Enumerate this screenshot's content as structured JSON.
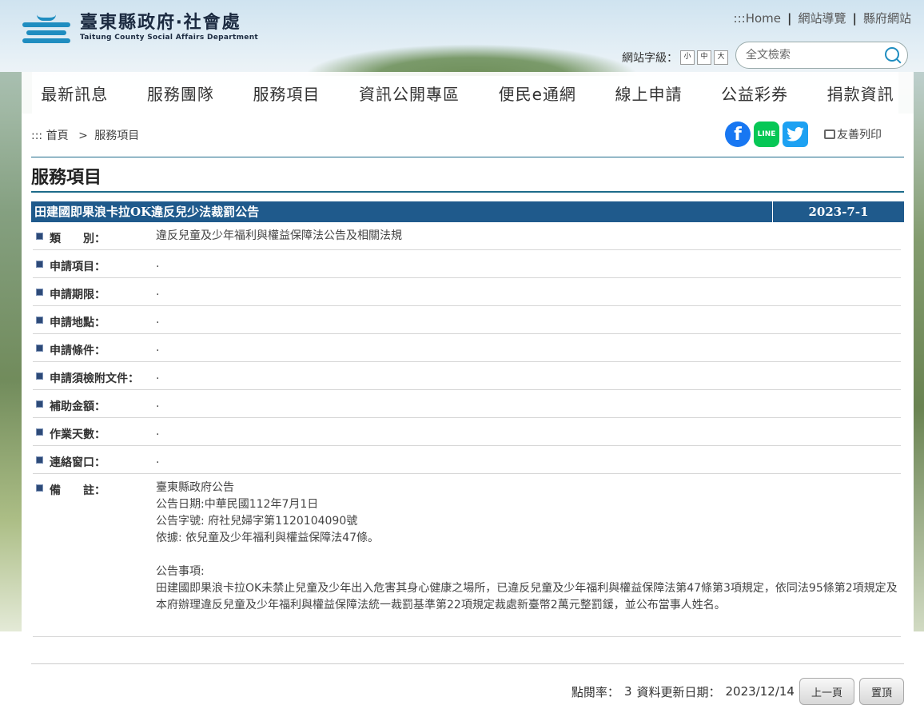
{
  "header": {
    "title": "臺東縣政府‧社會處",
    "subtitle": "Taitung County Social Affairs Department",
    "toplinks": [
      ":::Home",
      "網站導覽",
      "縣府網站"
    ],
    "font_size_label": "網站字級：",
    "font_sizes": [
      "小",
      "中",
      "大"
    ],
    "search_placeholder": "全文檢索"
  },
  "nav": [
    "最新訊息",
    "服務團隊",
    "服務項目",
    "資訊公開專區",
    "便民e通網",
    "線上申請",
    "公益彩券",
    "捐款資訊"
  ],
  "breadcrumb": {
    "home": "::: 首頁",
    "sep": ">",
    "current": "服務項目"
  },
  "social": {
    "line_label": "LINE",
    "print_label": "友善列印"
  },
  "page_title": "服務項目",
  "record": {
    "title": "田建國即果浪卡拉OK違反兒少法裁罰公告",
    "date": "2023-7-1"
  },
  "rows": [
    {
      "label": "類　　別：",
      "value": "違反兒童及少年福利與權益保障法公告及相關法規"
    },
    {
      "label": "申請項目：",
      "value": "."
    },
    {
      "label": "申請期限：",
      "value": "."
    },
    {
      "label": "申請地點：",
      "value": "."
    },
    {
      "label": "申請條件：",
      "value": "."
    },
    {
      "label": "申請須檢附文件：",
      "value": "."
    },
    {
      "label": "補助金額：",
      "value": "."
    },
    {
      "label": "作業天數：",
      "value": "."
    },
    {
      "label": "連絡窗口：",
      "value": "."
    },
    {
      "label": "備　　註：",
      "value": "臺東縣政府公告\n公告日期:中華民國112年7月1日\n公告字號: 府社兒婦字第1120104090號\n依據: 依兒童及少年福利與權益保障法47條。\n\n公告事項:\n田建國即果浪卡拉OK未禁止兒童及少年出入危害其身心健康之場所，已違反兒童及少年福利與權益保障法第47條第3項規定，依同法95條第2項規定及本府辦理違反兒童及少年福利與權益保障法統一裁罰基準第22項規定裁處新臺幣2萬元整罰鍰，並公布當事人姓名。"
    }
  ],
  "footer": {
    "views_label": "點閱率：",
    "views": "3",
    "updated_label": "資料更新日期：",
    "updated": "2023/12/14",
    "prev_button": "上一頁",
    "top_button": "置頂"
  }
}
